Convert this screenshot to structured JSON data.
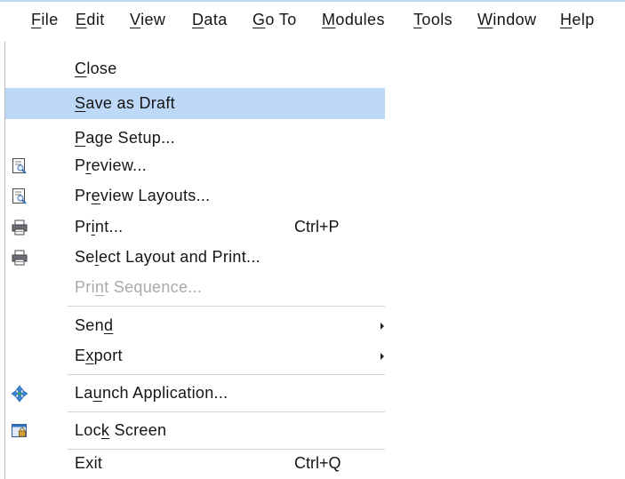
{
  "menubar": {
    "items": [
      {
        "label": "File",
        "mnemonic": "F"
      },
      {
        "label": "Edit",
        "mnemonic": "E"
      },
      {
        "label": "View",
        "mnemonic": "V"
      },
      {
        "label": "Data",
        "mnemonic": "D"
      },
      {
        "label": "Go To",
        "mnemonic": "G"
      },
      {
        "label": "Modules",
        "mnemonic": "M"
      },
      {
        "label": "Tools",
        "mnemonic": "T"
      },
      {
        "label": "Window",
        "mnemonic": "W"
      },
      {
        "label": "Help",
        "mnemonic": "H"
      }
    ]
  },
  "file_menu": {
    "items": [
      {
        "label": "Close",
        "mnemonic": "C",
        "icon": "",
        "shortcut": "",
        "submenu": false,
        "enabled": true,
        "highlighted": false
      },
      {
        "label": "Save as Draft",
        "mnemonic": "S",
        "icon": "",
        "shortcut": "",
        "submenu": false,
        "enabled": true,
        "highlighted": true
      },
      {
        "label": "Page Setup...",
        "mnemonic": "P",
        "icon": "",
        "shortcut": "",
        "submenu": false,
        "enabled": true,
        "highlighted": false
      },
      {
        "label": "Preview...",
        "mnemonic": "r",
        "icon": "preview-icon",
        "shortcut": "",
        "submenu": false,
        "enabled": true,
        "highlighted": false
      },
      {
        "label": "Preview Layouts...",
        "mnemonic": "e",
        "icon": "preview-layouts-icon",
        "shortcut": "",
        "submenu": false,
        "enabled": true,
        "highlighted": false
      },
      {
        "label": "Print...",
        "mnemonic": "i",
        "icon": "printer-icon",
        "shortcut": "Ctrl+P",
        "submenu": false,
        "enabled": true,
        "highlighted": false
      },
      {
        "label": "Select Layout and Print...",
        "mnemonic": "l",
        "icon": "printer-icon",
        "shortcut": "",
        "submenu": false,
        "enabled": true,
        "highlighted": false
      },
      {
        "label": "Print Sequence...",
        "mnemonic": "n",
        "icon": "",
        "shortcut": "",
        "submenu": false,
        "enabled": false,
        "highlighted": false
      },
      {
        "label": "Send",
        "mnemonic": "d",
        "icon": "",
        "shortcut": "",
        "submenu": true,
        "enabled": true,
        "highlighted": false
      },
      {
        "label": "Export",
        "mnemonic": "x",
        "icon": "",
        "shortcut": "",
        "submenu": true,
        "enabled": true,
        "highlighted": false
      },
      {
        "label": "Launch Application...",
        "mnemonic": "u",
        "icon": "launch-icon",
        "shortcut": "",
        "submenu": false,
        "enabled": true,
        "highlighted": false
      },
      {
        "label": "Lock Screen",
        "mnemonic": "k",
        "icon": "lock-screen-icon",
        "shortcut": "",
        "submenu": false,
        "enabled": true,
        "highlighted": false
      },
      {
        "label": "Exit",
        "mnemonic": "",
        "icon": "",
        "shortcut": "Ctrl+Q",
        "submenu": false,
        "enabled": true,
        "highlighted": false
      }
    ]
  },
  "colors": {
    "highlight": "#bdd9f7",
    "disabled_text": "#a9a9a9",
    "separator": "#d4d4d4",
    "accent_line": "#b9d7f3"
  }
}
